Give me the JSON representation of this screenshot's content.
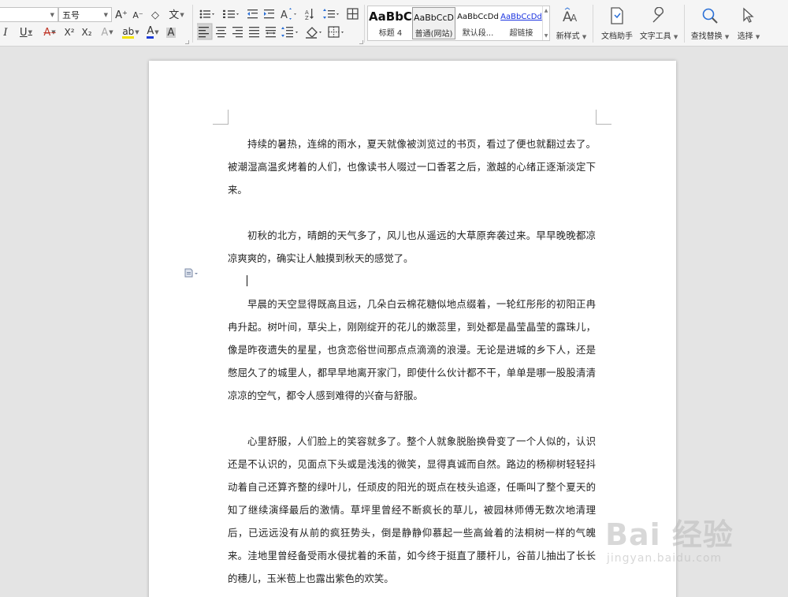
{
  "ribbon": {
    "font_name": "",
    "font_size": "五号",
    "styles": [
      {
        "preview": "AaBbC",
        "name": "标题 4"
      },
      {
        "preview": "AaBbCcD",
        "name": "普通(网站)"
      },
      {
        "preview": "AaBbCcDd",
        "name": "默认段..."
      },
      {
        "preview": "AaBbCcDd",
        "name": "超链接"
      }
    ],
    "new_style": "新样式",
    "doc_assistant": "文档助手",
    "text_tools": "文字工具",
    "find_replace": "查找替换",
    "select": "选择",
    "glyphs": {
      "grow_font": "A⁺",
      "shrink_font": "A⁻",
      "italic": "I",
      "underline": "U",
      "strike": "A",
      "superscript": "X²",
      "subscript": "X₂",
      "text_effect": "A",
      "highlight": "ab",
      "font_color": "A",
      "char_shading": "A",
      "pinyin": "文",
      "clear": "◇"
    }
  },
  "document": {
    "paragraphs": [
      "持续的暑热，连绵的雨水，夏天就像被浏览过的书页，看过了便也就翻过去了。被潮湿高温炙烤着的人们，也像读书人啜过一口香茗之后，激越的心绪正逐渐淡定下来。",
      "初秋的北方，晴朗的天气多了，风儿也从遥远的大草原奔袭过来。早早晚晚都凉凉爽爽的，确实让人触摸到秋天的感觉了。",
      "早晨的天空显得既高且远，几朵白云棉花糖似地点缀着，一轮红彤彤的初阳正冉冉升起。树叶间，草尖上，刚刚绽开的花儿的嫩蕊里，到处都是晶莹晶莹的露珠儿，像是昨夜遗失的星星，也贪恋俗世间那点点滴滴的浪漫。无论是进城的乡下人，还是憋屈久了的城里人，都早早地离开家门，即使什么伙计都不干，单单是哪一股股清清凉凉的空气，都令人感到难得的兴奋与舒服。",
      "心里舒服，人们脸上的笑容就多了。整个人就象脱胎换骨变了一个人似的，认识还是不认识的，见面点下头或是浅浅的微笑，显得真诚而自然。路边的杨柳树轻轻抖动着自己还算齐整的绿叶儿，任顽皮的阳光的斑点在枝头追逐，任嘶叫了整个夏天的知了继续演绎最后的激情。草坪里曾经不断疯长的草儿，被园林师傅无数次地清理后，已远远没有从前的疯狂势头，倒是静静仰慕起一些高耸着的法桐树一样的气魄来。洼地里曾经备受雨水侵扰着的禾苗，如今终于挺直了腰杆儿，谷苗儿抽出了长长的穗儿，玉米苞上也露出紫色的欢笑。"
    ]
  },
  "watermark": {
    "brand": "Bai 经验",
    "url": "jingyan.baidu.com"
  }
}
